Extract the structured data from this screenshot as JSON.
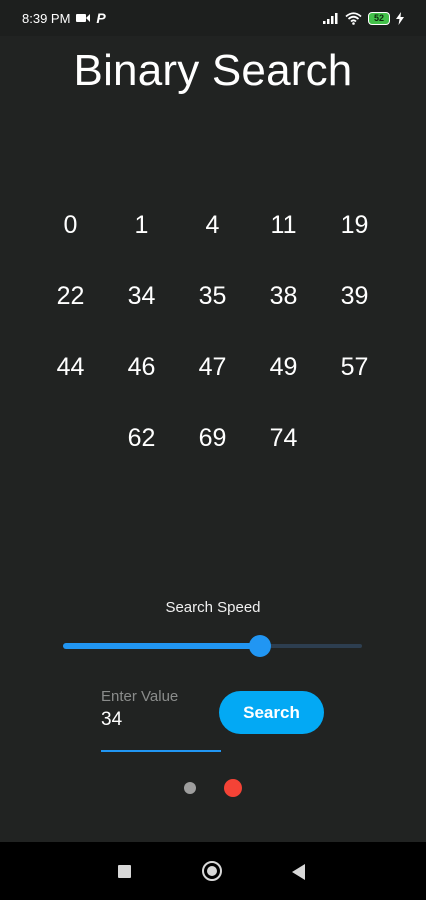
{
  "status": {
    "time": "8:39 PM",
    "battery": "52",
    "icons": [
      "video-camera-icon",
      "p-app-icon",
      "signal-icon",
      "wifi-icon",
      "battery-icon",
      "charging-bolt-icon"
    ]
  },
  "title": "Binary Search",
  "numbers": [
    "0",
    "1",
    "4",
    "11",
    "19",
    "22",
    "34",
    "35",
    "38",
    "39",
    "44",
    "46",
    "47",
    "49",
    "57",
    "62",
    "69",
    "74"
  ],
  "speed": {
    "label": "Search Speed",
    "value_fraction": 0.66
  },
  "input": {
    "label": "Enter Value",
    "value": "34"
  },
  "search_button": "Search",
  "page_indicator": {
    "count": 2,
    "active_index": 1
  },
  "colors": {
    "background": "#212322",
    "accent": "#2196f3",
    "button": "#03a9f4",
    "active_dot": "#f44336",
    "inactive_dot": "#9e9e9e"
  },
  "nav": {
    "icons": [
      "recents-square-icon",
      "home-circle-icon",
      "back-triangle-icon"
    ]
  }
}
